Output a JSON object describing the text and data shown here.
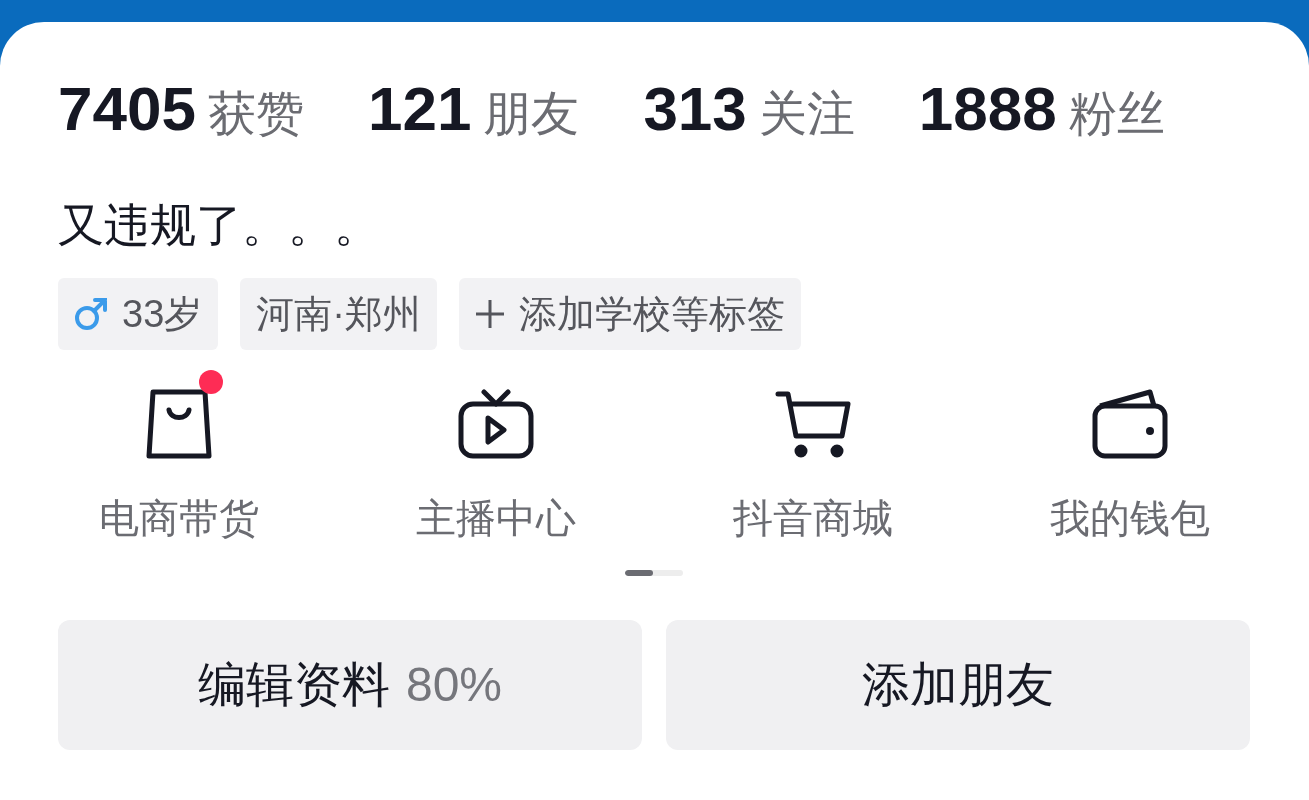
{
  "stats": [
    {
      "count": "7405",
      "caption": "获赞"
    },
    {
      "count": "121",
      "caption": "朋友"
    },
    {
      "count": "313",
      "caption": "关注"
    },
    {
      "count": "1888",
      "caption": "粉丝"
    }
  ],
  "bio": "又违规了。。。",
  "tags": [
    {
      "kind": "gender",
      "text": "33岁"
    },
    {
      "kind": "plain",
      "text": "河南·郑州"
    },
    {
      "kind": "add",
      "text": "添加学校等标签"
    }
  ],
  "shortcuts": [
    {
      "label": "电商带货",
      "notification": true
    },
    {
      "label": "主播中心",
      "notification": false
    },
    {
      "label": "抖音商城",
      "notification": false
    },
    {
      "label": "我的钱包",
      "notification": false
    }
  ],
  "buttons": [
    {
      "label": "编辑资料",
      "suffix": "80%"
    },
    {
      "label": "添加朋友"
    }
  ]
}
